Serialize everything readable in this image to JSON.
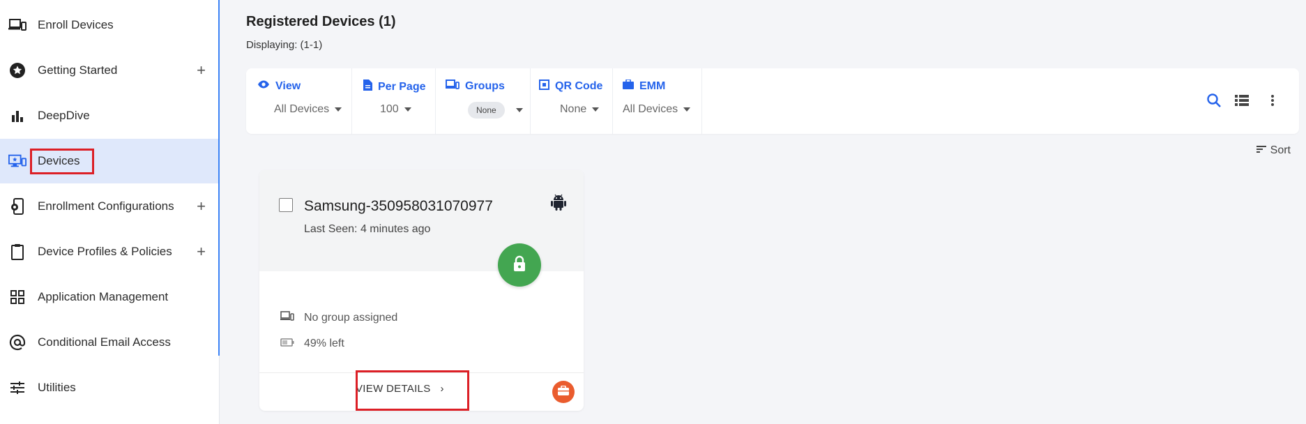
{
  "sidebar": {
    "items": [
      {
        "label": "Enroll Devices",
        "icon": "devices-icon",
        "expandable": false,
        "active": false
      },
      {
        "label": "Getting Started",
        "icon": "star-circle-icon",
        "expandable": true,
        "active": false
      },
      {
        "label": "DeepDive",
        "icon": "bar-chart-icon",
        "expandable": false,
        "active": false
      },
      {
        "label": "Devices",
        "icon": "monitor-phone-icon",
        "expandable": false,
        "active": true
      },
      {
        "label": "Enrollment Configurations",
        "icon": "phone-gear-icon",
        "expandable": true,
        "active": false
      },
      {
        "label": "Device Profiles & Policies",
        "icon": "clipboard-icon",
        "expandable": true,
        "active": false
      },
      {
        "label": "Application Management",
        "icon": "apps-grid-icon",
        "expandable": false,
        "active": false
      },
      {
        "label": "Conditional Email Access",
        "icon": "at-sign-icon",
        "expandable": false,
        "active": false
      },
      {
        "label": "Utilities",
        "icon": "sliders-icon",
        "expandable": false,
        "active": false
      }
    ],
    "plus_symbol": "+"
  },
  "main": {
    "title": "Registered Devices (1)",
    "subtitle": "Displaying: (1-1)",
    "toolbar": {
      "view": {
        "label": "View",
        "value": "All Devices"
      },
      "per_page": {
        "label": "Per Page",
        "value": "100"
      },
      "groups": {
        "label": "Groups",
        "value": "None"
      },
      "qr_code": {
        "label": "QR Code",
        "value": "None"
      },
      "emm": {
        "label": "EMM",
        "value": "All Devices"
      }
    },
    "sort_label": "Sort"
  },
  "device_card": {
    "name": "Samsung-350958031070977",
    "last_seen": "Last Seen: 4 minutes ago",
    "group": "No group assigned",
    "battery": "49% left",
    "view_details": "VIEW DETAILS",
    "chevron": "›"
  },
  "colors": {
    "accent": "#2563eb",
    "active_bg": "#dfe8fb",
    "lock_green": "#43a651",
    "briefcase_orange": "#ea5c2e",
    "highlight_red": "#dc1f26"
  }
}
